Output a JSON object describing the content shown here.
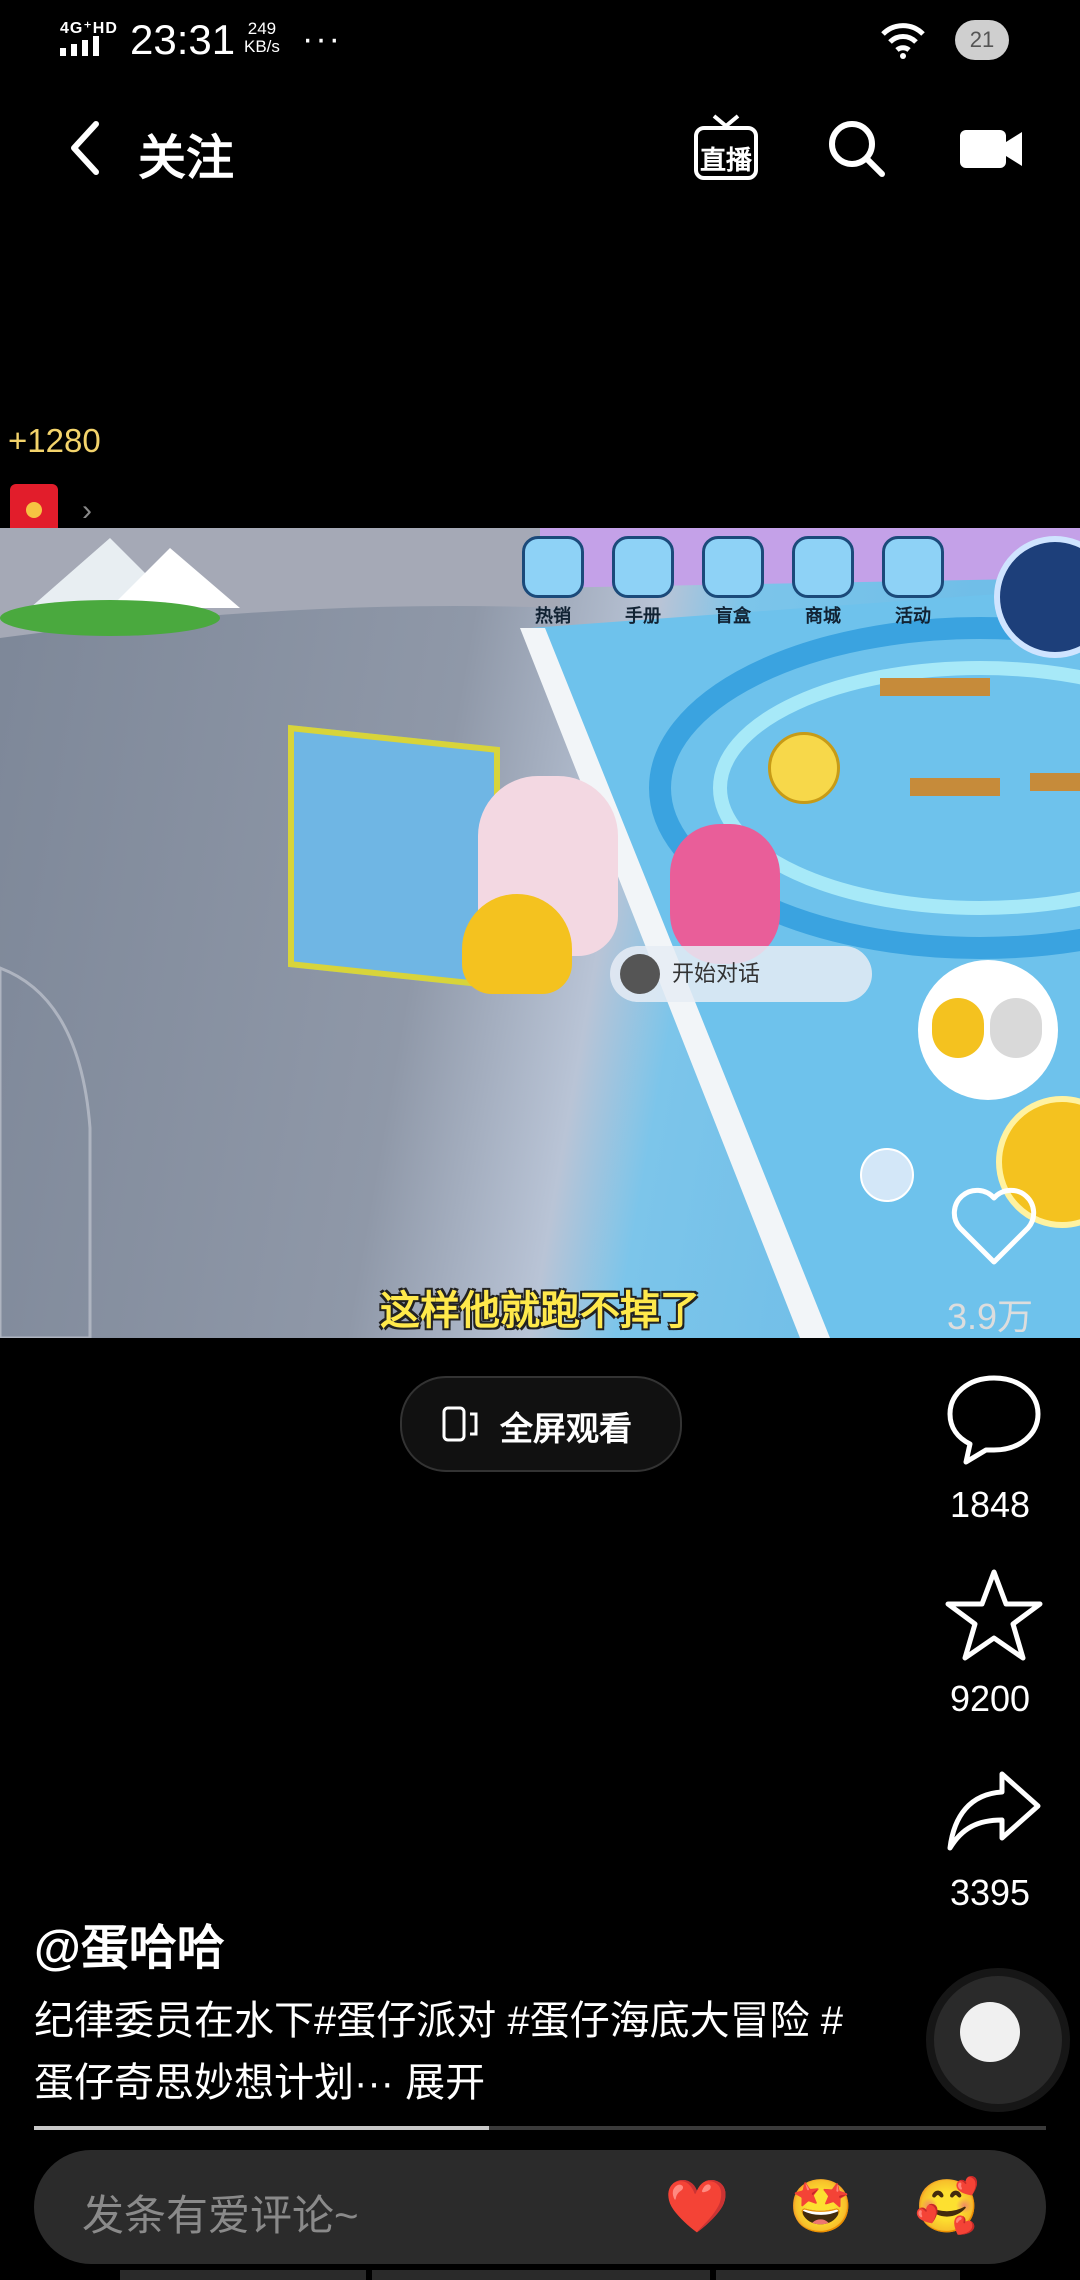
{
  "status_bar": {
    "network": "4G⁺HD",
    "time": "23:31",
    "speed_value": "249",
    "speed_unit": "KB/s",
    "more": "···",
    "battery": "21"
  },
  "header": {
    "back_icon": "chevron-left-icon",
    "title": "关注",
    "live_label": "直播",
    "search_icon": "search-icon",
    "camera_icon": "camera-icon"
  },
  "reward": {
    "coins": "+1280",
    "arrow": "›"
  },
  "video": {
    "game_menu": [
      "热销",
      "手册",
      "盲盒",
      "商城",
      "活动"
    ],
    "talk_button": "开始对话",
    "subtitle": "这样他就跑不掉了"
  },
  "actions": {
    "like_count": "3.9万",
    "comment_count": "1848",
    "favorite_count": "9200",
    "share_count": "3395"
  },
  "fullscreen_label": "全屏观看",
  "post": {
    "author": "@蛋哈哈",
    "description": "纪律委员在水下#蛋仔派对 #蛋仔海底大冒险 #蛋仔奇思妙想计划···",
    "expand": "展开",
    "progress": 0.45
  },
  "comment": {
    "placeholder": "发条有爱评论~",
    "emojis": [
      "❤️",
      "🤩",
      "🥰"
    ]
  },
  "colors": {
    "coins": "#f3d36b",
    "subtitle": "#ffe94b",
    "background": "#000000"
  }
}
